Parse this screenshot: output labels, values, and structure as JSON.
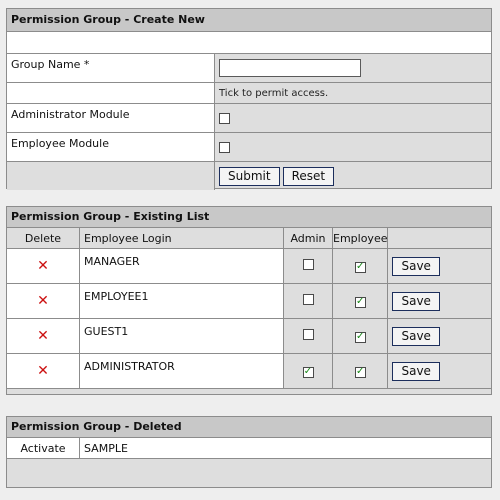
{
  "create": {
    "title": "Permission Group - Create New",
    "group_name_label": "Group Name *",
    "group_name_value": "",
    "tick_note": "Tick to permit access.",
    "modules": [
      {
        "label": "Administrator Module",
        "checked": false
      },
      {
        "label": "Employee Module",
        "checked": false
      }
    ],
    "submit_label": "Submit",
    "reset_label": "Reset"
  },
  "existing": {
    "title": "Permission Group - Existing List",
    "columns": [
      "Delete",
      "Employee Login",
      "Admin",
      "Employee",
      ""
    ],
    "save_label": "Save",
    "rows": [
      {
        "login": "MANAGER",
        "admin": false,
        "employee": true
      },
      {
        "login": "EMPLOYEE1",
        "admin": false,
        "employee": true
      },
      {
        "login": "GUEST1",
        "admin": false,
        "employee": true
      },
      {
        "login": "ADMINISTRATOR",
        "admin": true,
        "employee": true
      }
    ]
  },
  "deleted": {
    "title": "Permission Group - Deleted",
    "rows": [
      {
        "action": "Activate",
        "name": "SAMPLE"
      }
    ]
  },
  "icons": {
    "delete": "delete-x-icon",
    "check": "checkmark-icon"
  },
  "colors": {
    "delete_icon": "#cc1111",
    "checkmark": "#1a8a1a",
    "header_bg": "#c8c8c8",
    "panel_bg": "#dedede"
  }
}
